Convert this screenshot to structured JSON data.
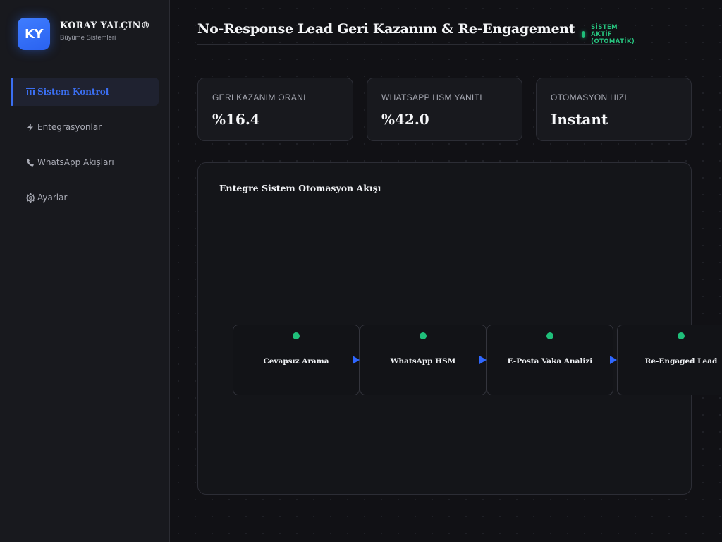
{
  "brand": {
    "logo_text": "KY",
    "name": "KORAY YALÇIN®",
    "subtitle": "Büyüme Sistemleri"
  },
  "sidebar": {
    "items": [
      {
        "icon": "columns-icon",
        "glyph": "🏛",
        "label": "Sistem Kontrol",
        "active": true
      },
      {
        "icon": "lightning-icon",
        "glyph": "⚡",
        "label": "Entegrasyonlar",
        "active": false
      },
      {
        "icon": "phone-icon",
        "glyph": "📞",
        "label": "WhatsApp Akışları",
        "active": false
      },
      {
        "icon": "gear-icon",
        "glyph": "⚙",
        "label": "Ayarlar",
        "active": false
      }
    ]
  },
  "header": {
    "title": "No-Response Lead Geri Kazanım & Re-Engagement",
    "status": "SİSTEM AKTİF (OTOMATİK)"
  },
  "stats": [
    {
      "label": "GERI KAZANIM ORANI",
      "value": "%16.4"
    },
    {
      "label": "WHATSAPP HSM YANITI",
      "value": "%42.0"
    },
    {
      "label": "OTOMASYON HIZI",
      "value": "Instant"
    }
  ],
  "flow": {
    "title": "Entegre Sistem Otomasyon Akışı",
    "nodes": [
      {
        "label": "Cevapsız Arama"
      },
      {
        "label": "WhatsApp HSM"
      },
      {
        "label": "E-Posta Vaka Analizi"
      },
      {
        "label": "Re-Engaged Lead"
      }
    ]
  },
  "colors": {
    "accent": "#3b6ff2",
    "status_green": "#1fbf7a",
    "background": "#111115"
  }
}
